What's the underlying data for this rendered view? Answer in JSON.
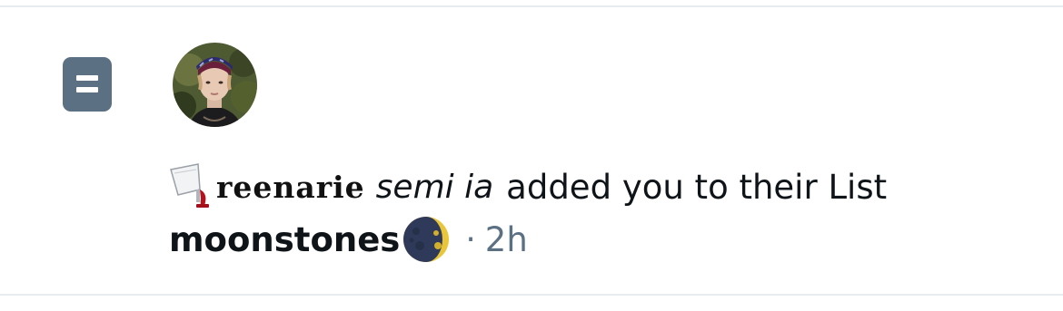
{
  "notification": {
    "type_icon": "list-icon",
    "actor": {
      "display_name_styled": "reenarie",
      "display_name_suffix": "semi ia",
      "prefix_emoji": "wine-glass-spill-emoji",
      "avatar": "profile-photo"
    },
    "action_text": "added you to their List",
    "list_name": "moonstones",
    "list_emoji": "moon-emoji",
    "separator": "·",
    "time": "2h"
  },
  "colors": {
    "icon_bg": "#5b7083",
    "text": "#0f1419",
    "muted": "#5b7083",
    "divider": "#e6ecf0"
  }
}
